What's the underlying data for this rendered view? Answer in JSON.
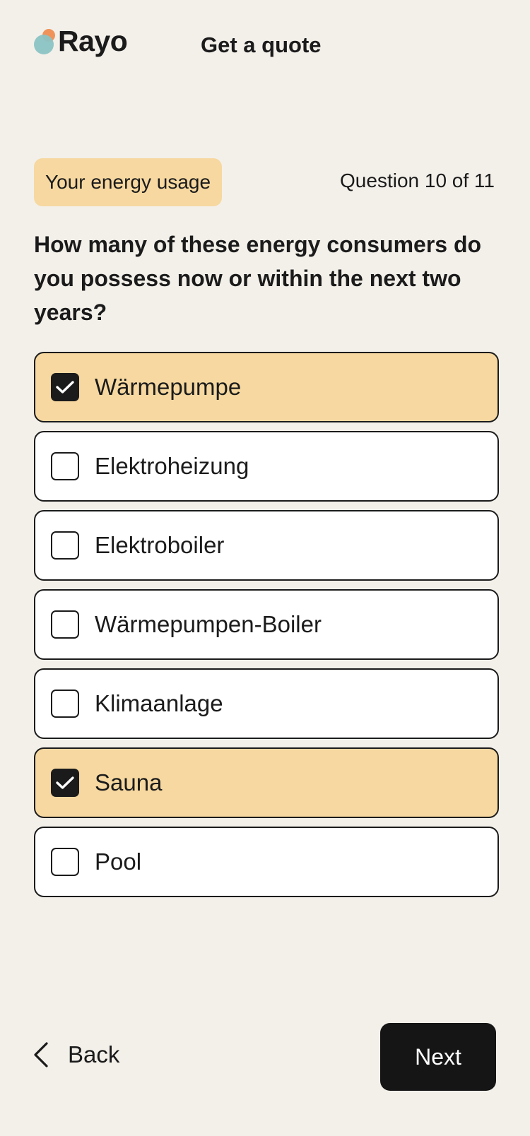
{
  "header": {
    "brand": "Rayo",
    "title": "Get a quote"
  },
  "section_badge": "Your energy usage",
  "progress_text": "Question 10 of 11",
  "question": "How many of these energy consumers do you possess now or within the next two years?",
  "options": [
    {
      "label": "Wärmepumpe",
      "checked": true
    },
    {
      "label": "Elektroheizung",
      "checked": false
    },
    {
      "label": "Elektroboiler",
      "checked": false
    },
    {
      "label": "Wärmepumpen-Boiler",
      "checked": false
    },
    {
      "label": "Klimaanlage",
      "checked": false
    },
    {
      "label": "Sauna",
      "checked": true
    },
    {
      "label": "Pool",
      "checked": false
    }
  ],
  "footer": {
    "back_label": "Back",
    "next_label": "Next"
  },
  "colors": {
    "background": "#f3f0ea",
    "selected": "#f6d8a0",
    "primary": "#151515",
    "logo_orange": "#f0935a",
    "logo_teal": "#8bc3c4"
  },
  "icons": {
    "back": "chevron-left-icon",
    "check": "checkmark-icon"
  }
}
